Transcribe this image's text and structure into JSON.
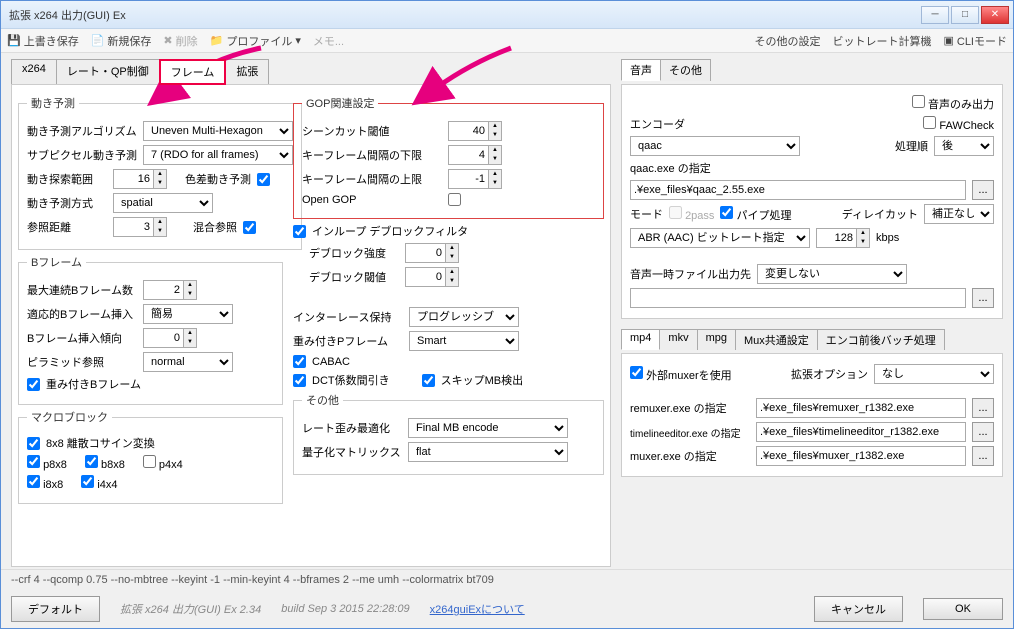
{
  "window": {
    "title": "拡張 x264 出力(GUI) Ex"
  },
  "toolbar": {
    "overwrite": "上書き保存",
    "new_save": "新規保存",
    "delete": "削除",
    "profile": "プロファイル",
    "memo": "メモ...",
    "other_settings": "その他の設定",
    "bitrate_calc": "ビットレート計算機",
    "cli_mode": "CLIモード"
  },
  "main_tabs": [
    "x264",
    "レート・QP制御",
    "フレーム",
    "拡張"
  ],
  "motion": {
    "legend": "動き予測",
    "algo_label": "動き予測アルゴリズム",
    "algo": "Uneven Multi-Hexagon",
    "subpx_label": "サブピクセル動き予測",
    "subpx": "7 (RDO for all frames)",
    "range_label": "動き探索範囲",
    "range": "16",
    "chroma_label": "色差動き予測",
    "method_label": "動き予測方式",
    "method": "spatial",
    "ref_label": "参照距離",
    "ref": "3",
    "mixed_label": "混合参照"
  },
  "bframe": {
    "legend": "Bフレーム",
    "max_label": "最大連続Bフレーム数",
    "max": "2",
    "adapt_label": "適応的Bフレーム挿入",
    "adapt": "簡易",
    "bias_label": "Bフレーム挿入傾向",
    "bias": "0",
    "pyramid_label": "ピラミッド参照",
    "pyramid": "normal",
    "weighted_label": "重み付きBフレーム"
  },
  "macro": {
    "legend": "マクロブロック",
    "dct_label": "8x8 離散コサイン変換",
    "p8": "p8x8",
    "b8": "b8x8",
    "p4": "p4x4",
    "i8": "i8x8",
    "i4": "i4x4"
  },
  "gop": {
    "legend": "GOP関連設定",
    "scenecut_label": "シーンカット閾値",
    "scenecut": "40",
    "min_label": "キーフレーム間隔の下限",
    "min": "4",
    "max_label": "キーフレーム間隔の上限",
    "max": "-1",
    "open_label": "Open GOP"
  },
  "deblock": {
    "loop_label": "インループ デブロックフィルタ",
    "strength_label": "デブロック強度",
    "strength": "0",
    "thresh_label": "デブロック閾値",
    "thresh": "0"
  },
  "misc_left": {
    "interlace_label": "インターレース保持",
    "interlace": "プログレッシブ",
    "wpred_label": "重み付きPフレーム",
    "wpred": "Smart",
    "cabac": "CABAC",
    "dct_decimate": "DCT係数間引き",
    "skip_mb": "スキップMB検出"
  },
  "other": {
    "legend": "その他",
    "rd_label": "レート歪み最適化",
    "rd": "Final MB encode",
    "qm_label": "量子化マトリックス",
    "qm": "flat"
  },
  "audio": {
    "tabs": [
      "音声",
      "その他"
    ],
    "audio_only": "音声のみ出力",
    "encoder_label": "エンコーダ",
    "encoder": "qaac",
    "faw": "FAWCheck",
    "order_label": "処理順",
    "order": "後",
    "exe_label": "qaac.exe の指定",
    "exe": ".¥exe_files¥qaac_2.55.exe",
    "mode_label": "モード",
    "twopass": "2pass",
    "pipe": "パイプ処理",
    "delay_label": "ディレイカット",
    "delay": "補正なし",
    "mode": "ABR (AAC) ビットレート指定",
    "bitrate": "128",
    "kbps": "kbps",
    "tmp_label": "音声一時ファイル出力先",
    "tmp": "変更しない"
  },
  "mux": {
    "tabs": [
      "mp4",
      "mkv",
      "mpg",
      "Mux共通設定",
      "エンコ前後バッチ処理"
    ],
    "ext_muxer": "外部muxerを使用",
    "ext_opt_label": "拡張オプション",
    "ext_opt": "なし",
    "remuxer_label": "remuxer.exe の指定",
    "remuxer": ".¥exe_files¥remuxer_r1382.exe",
    "tl_label": "timelineeditor.exe の指定",
    "tl": ".¥exe_files¥timelineeditor_r1382.exe",
    "muxer_label": "muxer.exe の指定",
    "muxer": ".¥exe_files¥muxer_r1382.exe"
  },
  "cmdline": "--crf 4 --qcomp 0.75 --no-mbtree --keyint -1 --min-keyint 4 --bframes 2 --me umh --colormatrix bt709",
  "footer": {
    "default": "デフォルト",
    "version": "拡張 x264 出力(GUI) Ex 2.34",
    "build": "build Sep  3 2015 22:28:09",
    "about": "x264guiExについて",
    "cancel": "キャンセル",
    "ok": "OK"
  }
}
